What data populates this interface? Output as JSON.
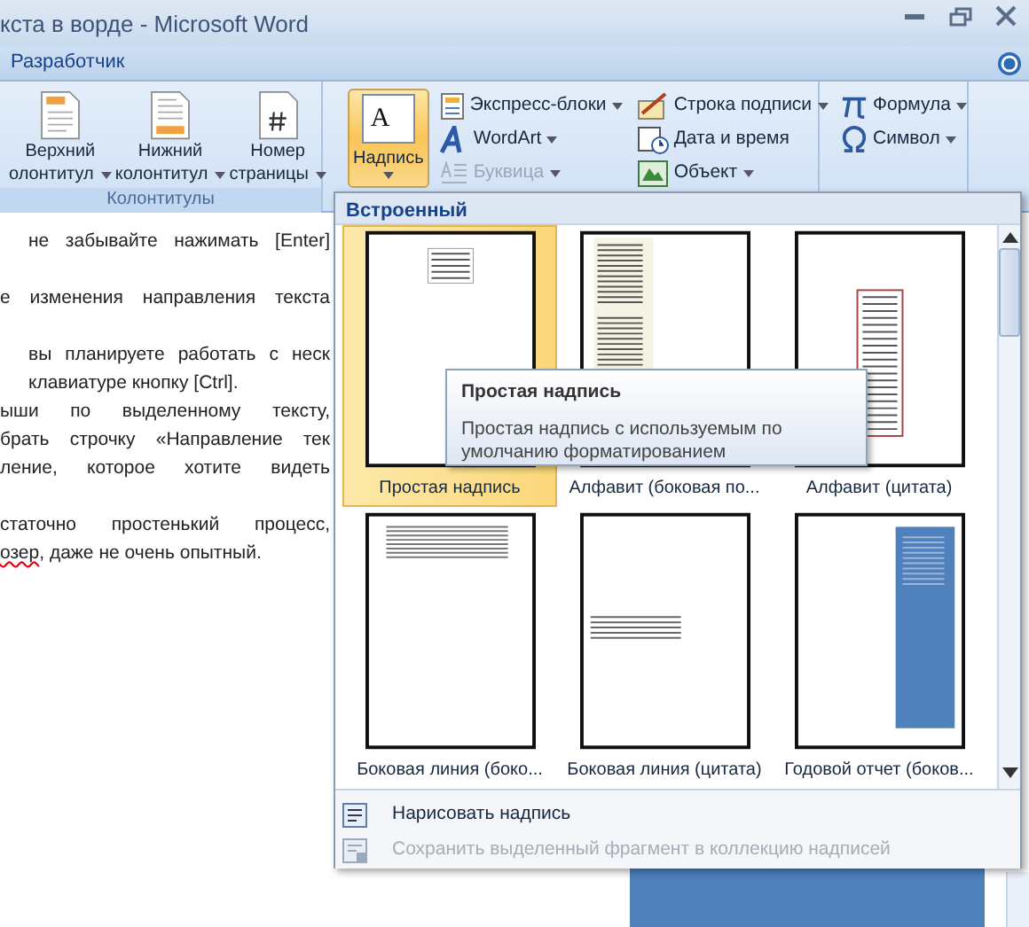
{
  "window": {
    "title": "кста в ворде - Microsoft Word"
  },
  "ribbon_tab": "Разработчик",
  "ribbon": {
    "groups": [
      {
        "label": "Колонтитулы",
        "buttons": [
          {
            "kind": "header",
            "lines": [
              "Верхний",
              "олонтитул"
            ],
            "dropdown": true
          },
          {
            "kind": "footer",
            "lines": [
              "Нижний",
              "колонтитул"
            ],
            "dropdown": true
          },
          {
            "kind": "pagenum",
            "lines": [
              "Номер",
              "страницы"
            ],
            "dropdown": true
          }
        ]
      },
      {
        "big": {
          "label": "Надпись",
          "icon_text": "A",
          "selected": true,
          "dropdown": true
        },
        "columns": [
          [
            {
              "kind": "blocks",
              "label": "Экспресс-блоки",
              "dropdown": true,
              "disabled": false
            },
            {
              "kind": "wordart",
              "label": "WordArt",
              "dropdown": true,
              "disabled": false
            },
            {
              "kind": "dropcap",
              "label": "Буквица",
              "dropdown": true,
              "disabled": true
            }
          ],
          [
            {
              "kind": "signature",
              "label": "Строка подписи",
              "dropdown": true,
              "disabled": false
            },
            {
              "kind": "datetime",
              "label": "Дата и время",
              "dropdown": false,
              "disabled": false
            },
            {
              "kind": "object",
              "label": "Объект",
              "dropdown": true,
              "disabled": false
            }
          ]
        ]
      },
      {
        "items": [
          {
            "kind": "pi",
            "label": "Формула",
            "dropdown": true
          },
          {
            "kind": "omega",
            "label": "Символ",
            "dropdown": true
          }
        ]
      }
    ]
  },
  "document": {
    "lines": [
      {
        "text": "не забывайте нажимать [Enter]",
        "indent": true,
        "justify": true,
        "gap_before": false
      },
      {
        "text": "е изменения направления текста",
        "indent": false,
        "justify": true,
        "gap_before": true
      },
      {
        "text": "вы планируете работать с неск",
        "indent": true,
        "justify": true,
        "gap_before": true
      },
      {
        "text": "клавиатуре кнопку [Ctrl].",
        "indent": true,
        "justify": false,
        "gap_before": false
      },
      {
        "text": "ыши по выделенному тексту,",
        "indent": false,
        "justify": true,
        "gap_before": false
      },
      {
        "text": "брать строчку «Направление тек",
        "indent": false,
        "justify": true,
        "gap_before": false
      },
      {
        "text": "ление, которое хотите видеть",
        "indent": false,
        "justify": true,
        "gap_before": false
      },
      {
        "text": "статочно простенький процесс,",
        "indent": false,
        "justify": true,
        "gap_before": true
      },
      {
        "segments": [
          {
            "text": "озер",
            "misspelled": true
          },
          {
            "text": ", даже не очень опытный.",
            "misspelled": false
          }
        ],
        "indent": false,
        "justify": false,
        "gap_before": false
      }
    ]
  },
  "gallery": {
    "heading": "Встроенный",
    "items": [
      {
        "label": "Простая надпись",
        "kind": "simple",
        "selected": true
      },
      {
        "label": "Алфавит (боковая по...",
        "kind": "alphabet-side",
        "selected": false
      },
      {
        "label": "Алфавит (цитата)",
        "kind": "alphabet-quote",
        "selected": false
      },
      {
        "label": "Боковая линия (боко...",
        "kind": "sideline-side",
        "selected": false
      },
      {
        "label": "Боковая линия (цитата)",
        "kind": "sideline-quote",
        "selected": false
      },
      {
        "label": "Годовой отчет (боков...",
        "kind": "annual",
        "selected": false
      }
    ],
    "tooltip": {
      "title": "Простая надпись",
      "text": "Простая надпись с используемым по умолчанию форматированием"
    },
    "menu": [
      {
        "kind": "draw",
        "label": "Нарисовать надпись",
        "disabled": false
      },
      {
        "kind": "save",
        "label": "Сохранить выделенный фрагмент в коллекцию надписей",
        "disabled": true
      }
    ]
  }
}
